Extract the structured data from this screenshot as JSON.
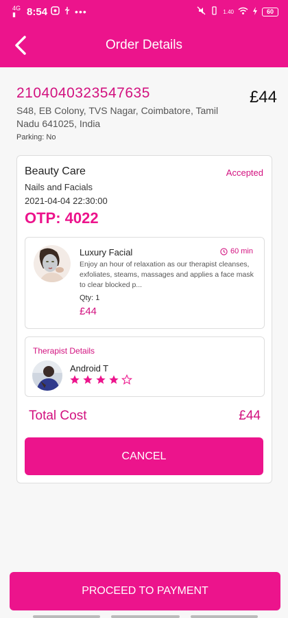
{
  "status_bar": {
    "time": "8:54",
    "left_icons": [
      "signal-4g-icon",
      "whatsapp-icon",
      "usb-icon",
      "more-dots-icon"
    ],
    "network_label": "1.40",
    "battery": "60"
  },
  "app_bar": {
    "title": "Order Details",
    "back_icon": "chevron-left-icon"
  },
  "order": {
    "id": "2104040323547635",
    "price": "£44",
    "address": "S48, EB Colony, TVS Nagar, Coimbatore, Tamil Nadu 641025, India",
    "parking": "Parking: No"
  },
  "booking": {
    "category": "Beauty Care",
    "status": "Accepted",
    "subcategory": "Nails and Facials",
    "datetime": "2021-04-04 22:30:00",
    "otp": "OTP: 4022"
  },
  "service_item": {
    "name": "Luxury Facial",
    "duration": "60 min",
    "description": "Enjoy an hour of relaxation as our therapist cleanses, exfoliates, steams, massages and applies a face mask to clear blocked p...",
    "qty": "Qty: 1",
    "price": "£44"
  },
  "therapist": {
    "label": "Therapist Details",
    "name": "Android T",
    "rating": 4,
    "rating_max": 5
  },
  "total": {
    "label": "Total Cost",
    "value": "£44"
  },
  "actions": {
    "cancel_label": "CANCEL",
    "proceed_label": "PROCEED TO PAYMENT"
  },
  "colors": {
    "accent": "#ec148c",
    "accent_text": "#d2117f",
    "background": "#f7f7f7"
  }
}
